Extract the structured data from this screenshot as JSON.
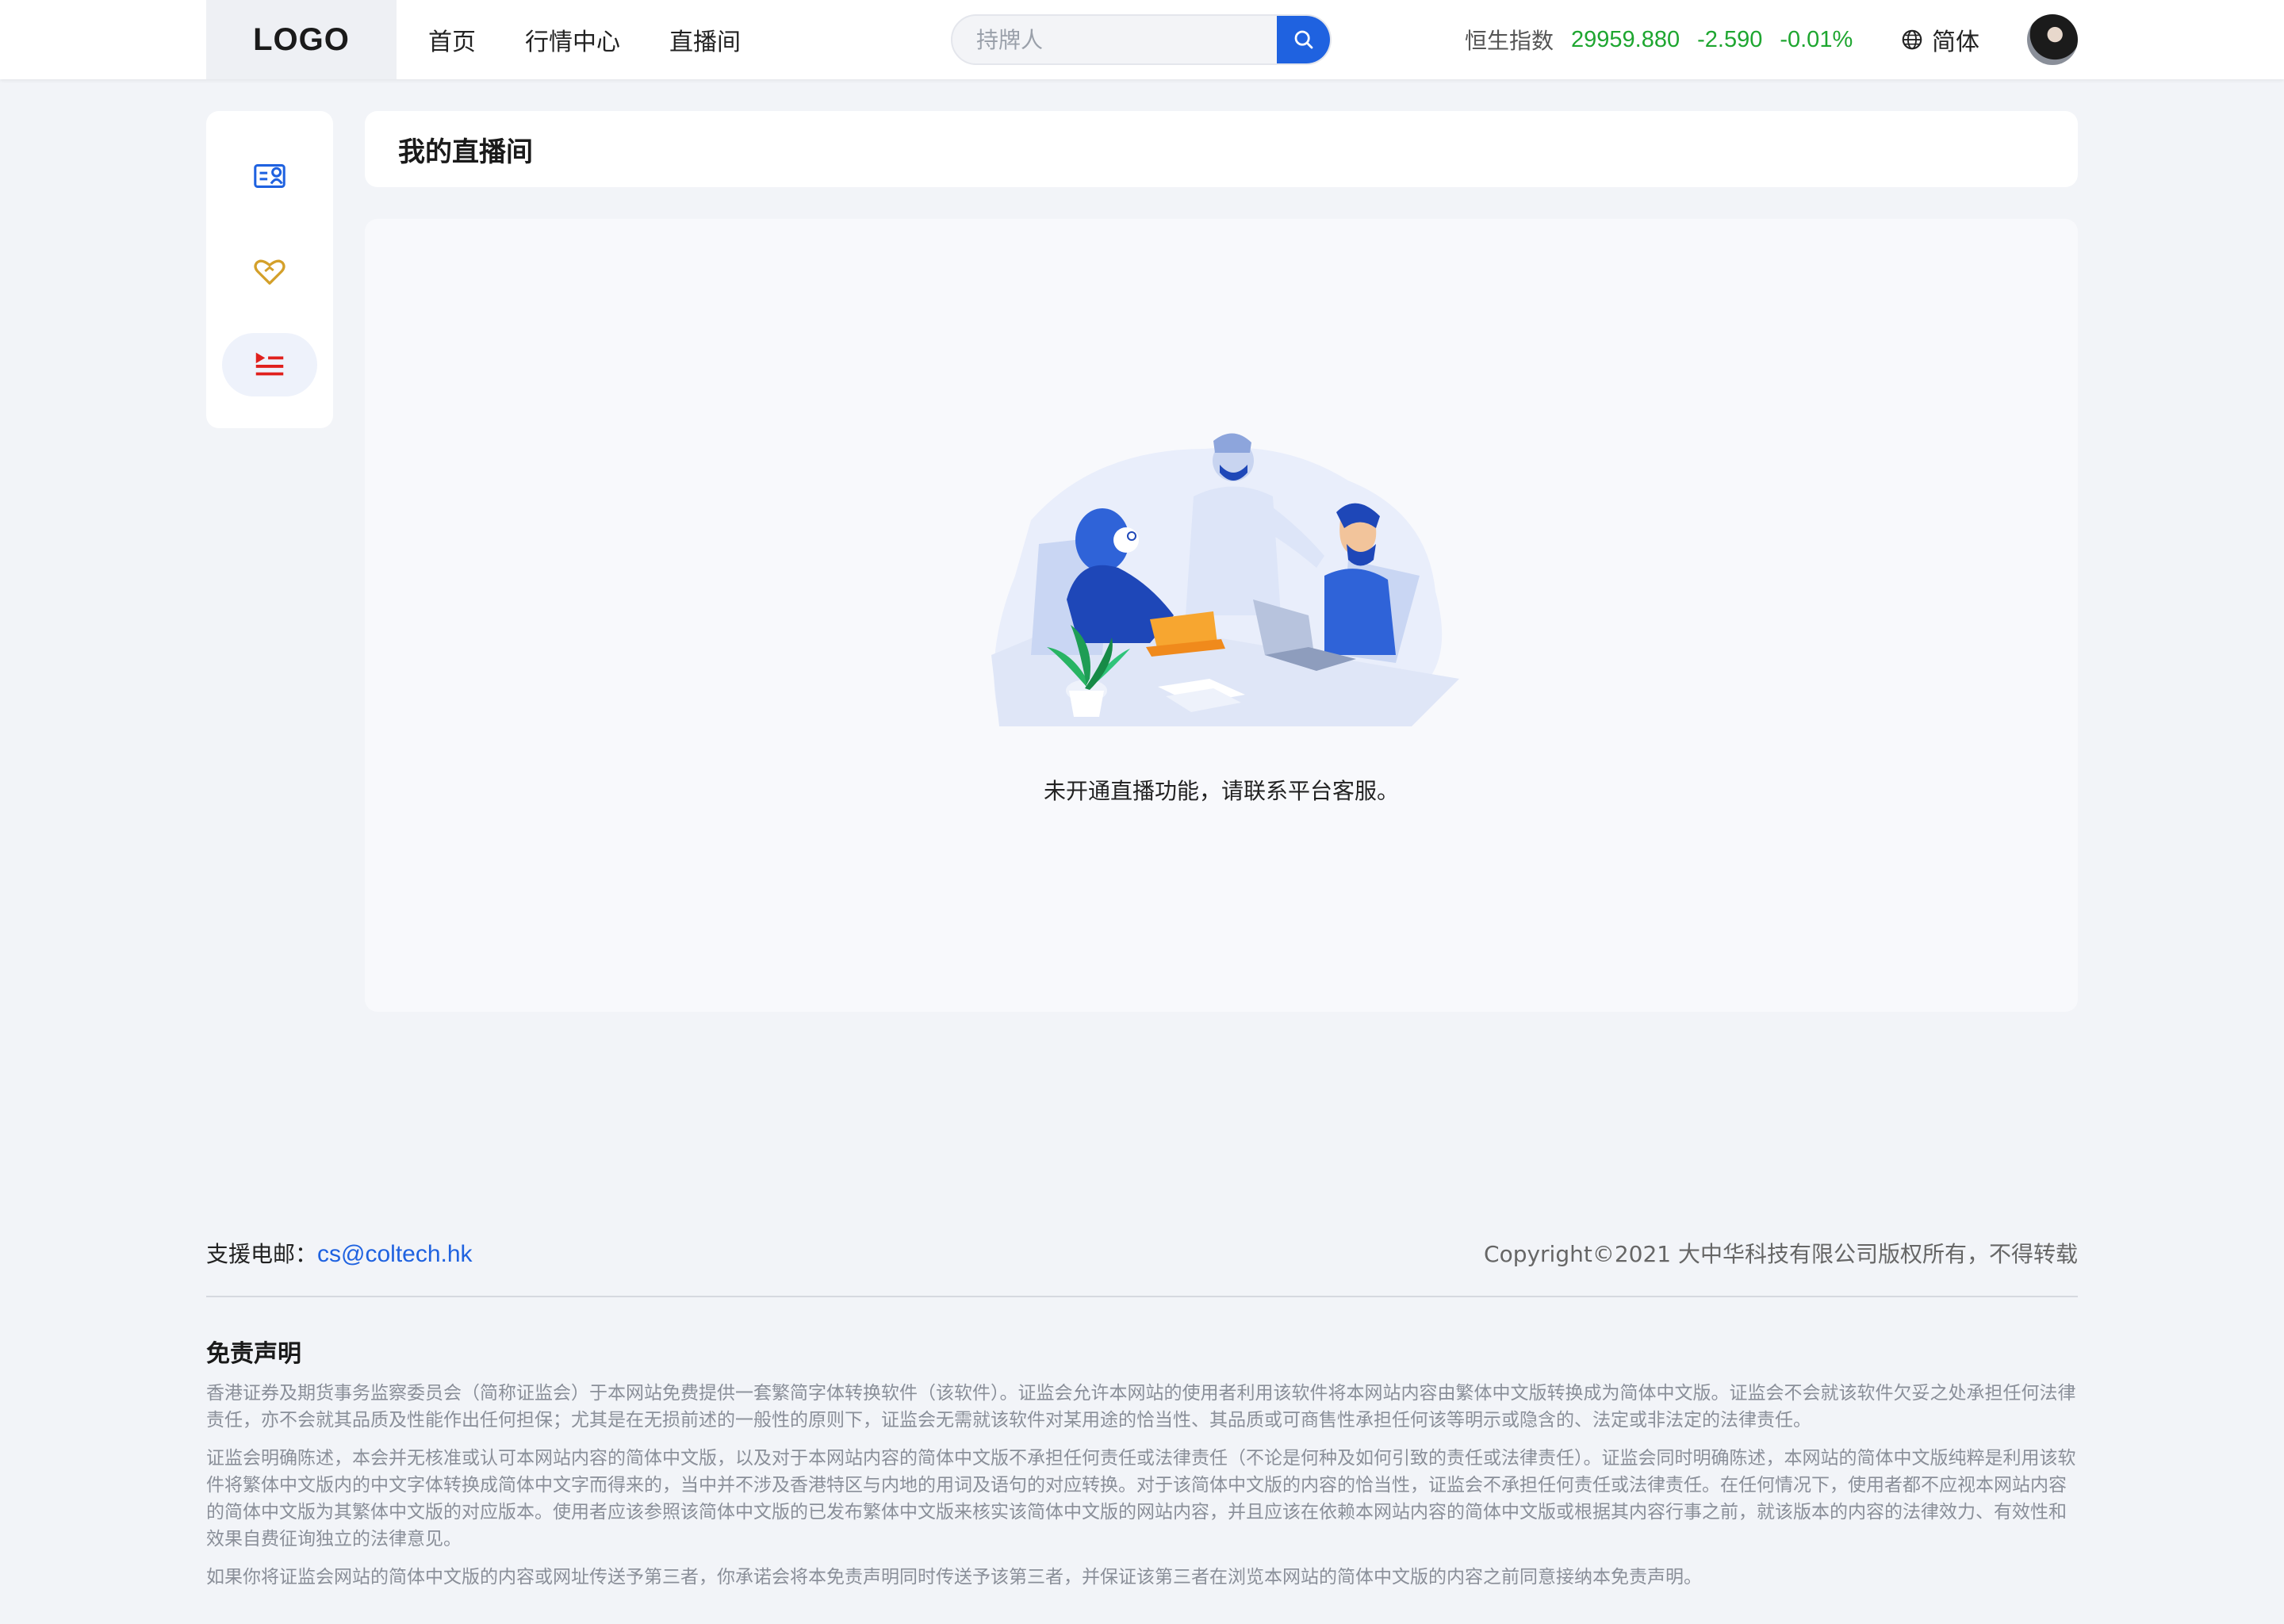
{
  "header": {
    "logo": "LOGO",
    "nav": [
      "首页",
      "行情中心",
      "直播间"
    ],
    "search_placeholder": "持牌人",
    "index": {
      "label": "恒生指数",
      "value": "29959.880",
      "change": "-2.590",
      "percent": "-0.01%",
      "color": "#1ea630"
    },
    "language": "简体"
  },
  "sidebar": {
    "items": [
      {
        "icon": "profile-card-icon",
        "color": "#1f62e0"
      },
      {
        "icon": "heart-icon",
        "color": "#d4a02a"
      },
      {
        "icon": "play-list-icon",
        "color": "#e0201c",
        "active": true
      }
    ]
  },
  "main": {
    "title": "我的直播间",
    "empty_message": "未开通直播功能，请联系平台客服。"
  },
  "footer": {
    "support_label": "支援电邮：",
    "support_email": "cs@coltech.hk",
    "copyright": "Copyright©2021 大中华科技有限公司版权所有，不得转载",
    "disclaimer_title": "免责声明",
    "disclaimer": [
      "香港证券及期货事务监察委员会（简称证监会）于本网站免费提供一套繁简字体转换软件（该软件）。证监会允许本网站的使用者利用该软件将本网站内容由繁体中文版转换成为简体中文版。证监会不会就该软件欠妥之处承担任何法律责任，亦不会就其品质及性能作出任何担保；尤其是在无损前述的一般性的原则下，证监会无需就该软件对某用途的恰当性、其品质或可商售性承担任何该等明示或隐含的、法定或非法定的法律责任。",
      "证监会明确陈述，本会并无核准或认可本网站内容的简体中文版，以及对于本网站内容的简体中文版不承担任何责任或法律责任（不论是何种及如何引致的责任或法律责任）。证监会同时明确陈述，本网站的简体中文版纯粹是利用该软件将繁体中文版内的中文字体转换成简体中文字而得来的，当中并不涉及香港特区与内地的用词及语句的对应转换。对于该简体中文版的内容的恰当性，证监会不承担任何责任或法律责任。在任何情况下，使用者都不应视本网站内容的简体中文版为其繁体中文版的对应版本。使用者应该参照该简体中文版的已发布繁体中文版来核实该简体中文版的网站内容，并且应该在依赖本网站内容的简体中文版或根据其内容行事之前，就该版本的内容的法律效力、有效性和效果自费征询独立的法律意见。",
      "如果你将证监会网站的简体中文版的内容或网址传送予第三者，你承诺会将本免责声明同时传送予该第三者，并保证该第三者在浏览本网站的简体中文版的内容之前同意接纳本免责声明。"
    ]
  }
}
